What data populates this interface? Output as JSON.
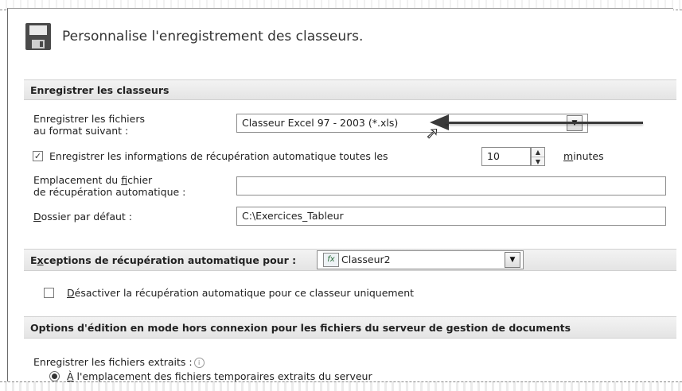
{
  "header": {
    "title": "Personnalise l'enregistrement des classeurs."
  },
  "save_section": {
    "title": "Enregistrer les classeurs",
    "format_label_line1": "Enregistrer les fichiers",
    "format_label_line2": "au format suivant :",
    "format_value": "Classeur Excel 97 - 2003 (*.xls)",
    "autorecover_checked": true,
    "autorecover_label_pre": "Enregistrer les inform",
    "autorecover_label_key": "a",
    "autorecover_label_post": "tions de récupération automatique toutes les",
    "autorecover_minutes": "10",
    "minutes_key": "m",
    "minutes_rest": "inutes",
    "location_label_line1_pre": "Emplacement du ",
    "location_label_line1_key": "f",
    "location_label_line1_post": "ichier",
    "location_label_line2": "de récupération automatique :",
    "location_value": "",
    "default_folder_key": "D",
    "default_folder_rest": "ossier par défaut :",
    "default_folder_value": "C:\\Exercices_Tableur"
  },
  "exceptions_section": {
    "title_pre": "E",
    "title_key": "x",
    "title_post": "ceptions de récupération automatique pour :",
    "workbook": "Classeur2",
    "disable_checked": false,
    "disable_key": "D",
    "disable_rest": "ésactiver la récupération automatique pour ce classeur uniquement"
  },
  "offline_section": {
    "title": "Options d'édition en mode hors connexion pour les fichiers du serveur de gestion de documents",
    "checkout_label": "Enregistrer les fichiers extraits :",
    "info_glyph": "i",
    "radio1_selected": true,
    "radio1_key": "À",
    "radio1_rest": " l'emplacement des fichiers temporaires extraits du serveur"
  },
  "icons": {
    "save": "floppy-disk-icon",
    "dropdown": "chevron-down-icon",
    "excel": "excel-workbook-icon",
    "info": "info-icon",
    "cursor": "mouse-pointer-icon",
    "annotation_arrow": "arrow-left-annotation"
  }
}
